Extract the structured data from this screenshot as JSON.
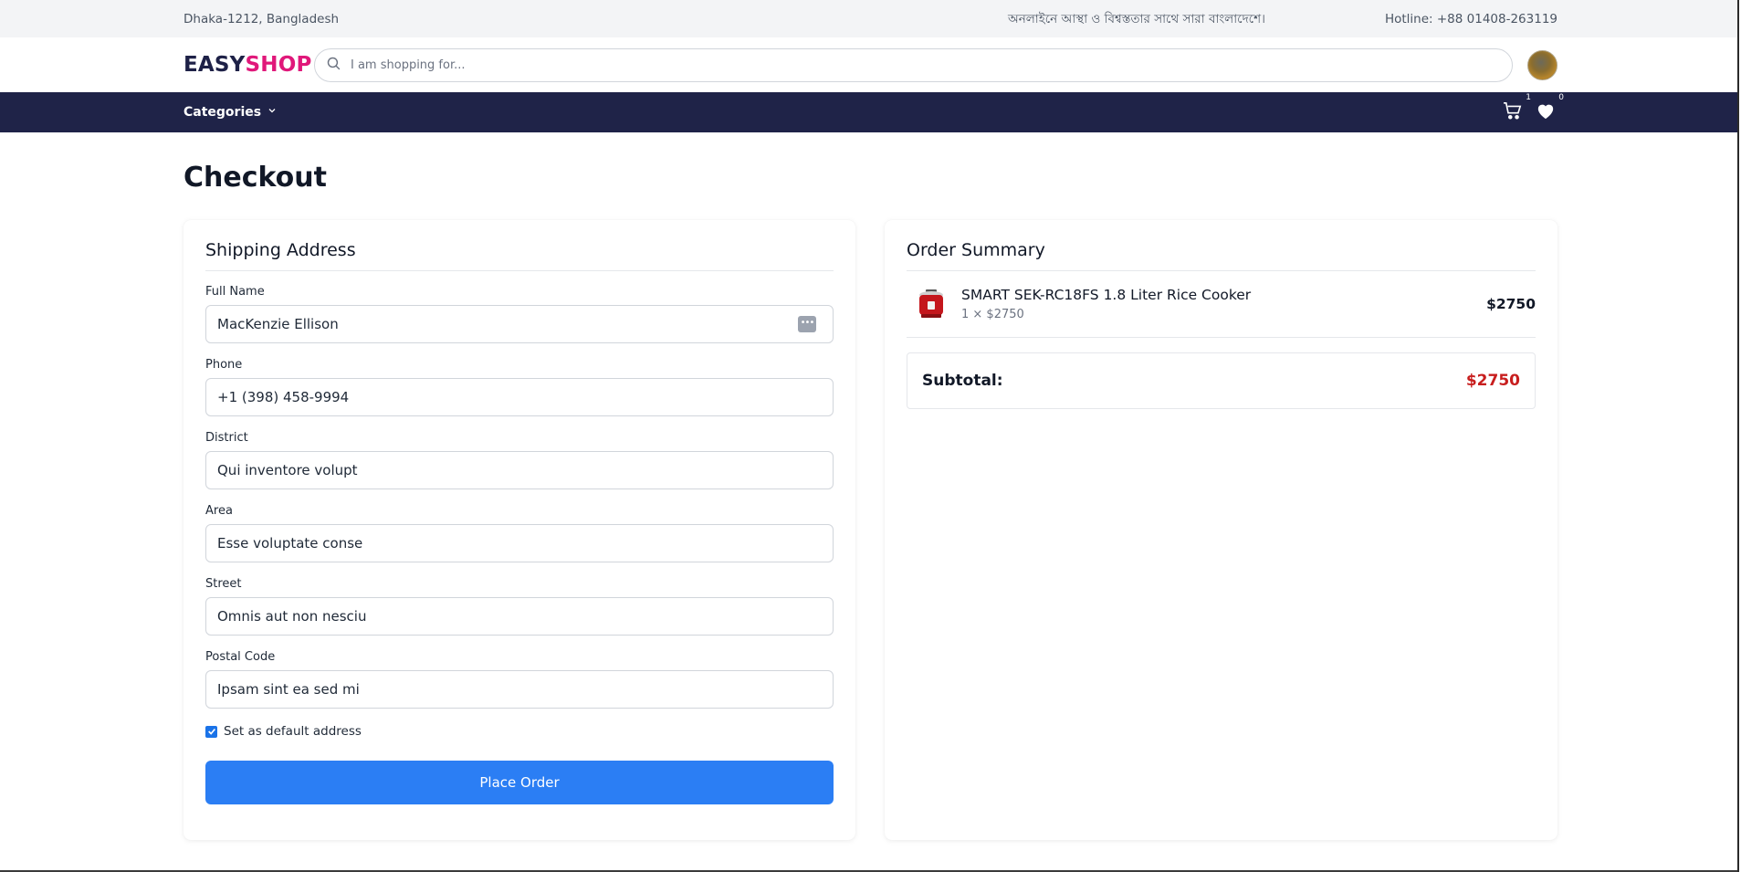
{
  "topbar": {
    "location": "Dhaka-1212, Bangladesh",
    "tagline": "অনলাইনে আস্থা ও বিশ্বস্ততার সাথে সারা বাংলাদেশে।",
    "hotline": "Hotline: +88 01408-263119"
  },
  "header": {
    "logo_part1": "EASY",
    "logo_part2": "SHOP",
    "search_placeholder": "I am shopping for..."
  },
  "navbar": {
    "categories_label": "Categories",
    "cart_count": "1",
    "wishlist_count": "0"
  },
  "page": {
    "title": "Checkout"
  },
  "shipping": {
    "heading": "Shipping Address",
    "fields": [
      {
        "label": "Full Name",
        "value": "MacKenzie Ellison"
      },
      {
        "label": "Phone",
        "value": "+1 (398) 458-9994"
      },
      {
        "label": "District",
        "value": "Qui inventore volupt"
      },
      {
        "label": "Area",
        "value": "Esse voluptate conse"
      },
      {
        "label": "Street",
        "value": "Omnis aut non nesciu"
      },
      {
        "label": "Postal Code",
        "value": "Ipsam sint ea sed mi"
      }
    ],
    "default_checkbox_label": "Set as default address",
    "default_checked": true,
    "place_order_label": "Place Order"
  },
  "order": {
    "heading": "Order Summary",
    "items": [
      {
        "name": "SMART SEK-RC18FS 1.8 Liter Rice Cooker",
        "qty_line": "1 × $2750",
        "price": "$2750"
      }
    ],
    "subtotal_label": "Subtotal:",
    "subtotal_value": "$2750"
  },
  "colors": {
    "brand_dark": "#1e2147",
    "brand_pink": "#e0187a",
    "nav_bg": "#1f2348",
    "button_blue": "#2b7ef4",
    "subtotal_red": "#c81e1e"
  }
}
